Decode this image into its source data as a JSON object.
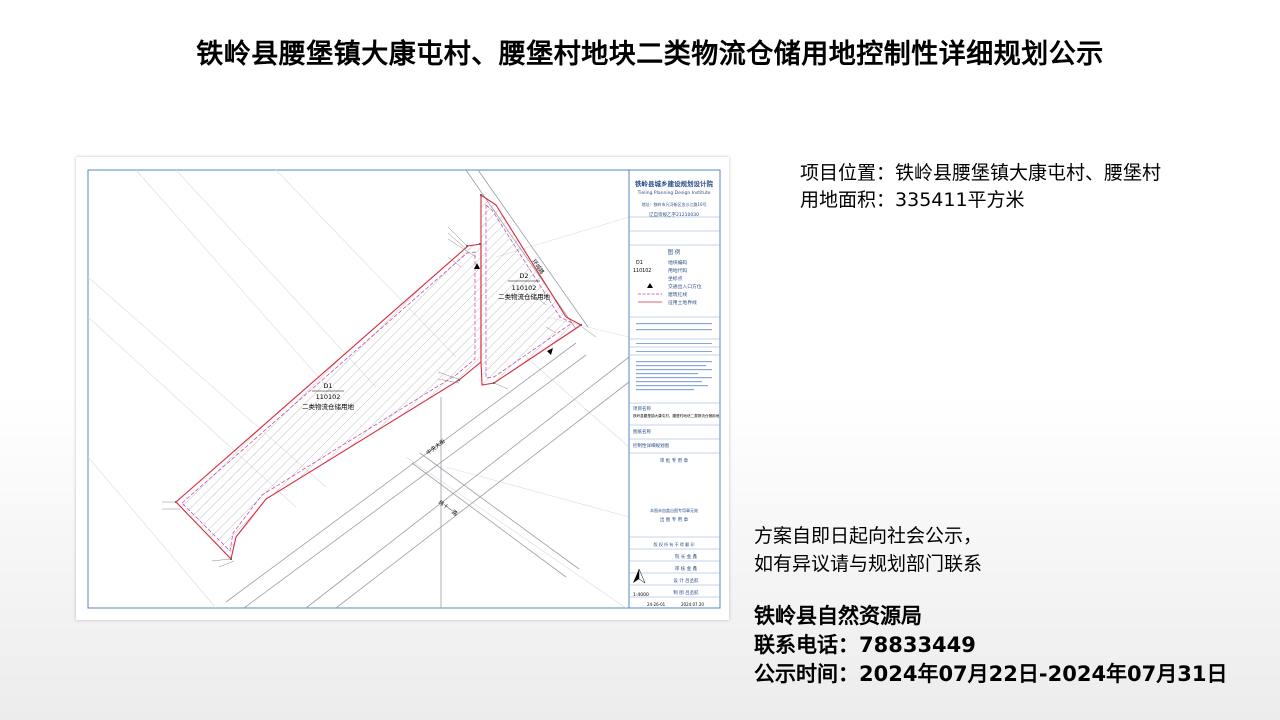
{
  "page": {
    "title": "铁岭县腰堡镇大康屯村、腰堡村地块二类物流仓储用地控制性详细规划公示"
  },
  "info": {
    "location_label": "项目位置：",
    "location_value": "铁岭县腰堡镇大康屯村、腰堡村",
    "area_label": "用地面积：",
    "area_value": "335411平方米"
  },
  "notice": {
    "line1": "方案自即日起向社会公示，",
    "line2": "如有异议请与规划部门联系"
  },
  "footer": {
    "org": "铁岭县自然资源局",
    "phone_label": "联系电话：",
    "phone_value": "78833449",
    "date_label": "公示时间：",
    "date_value": "2024年07月22日-2024年07月31日"
  },
  "map": {
    "parcel_d1": {
      "code": "D1",
      "landuse": "110102",
      "name": "二类物流仓储用地"
    },
    "parcel_d2": {
      "code": "D2",
      "landuse": "110102",
      "name": "二类物流仓储用地"
    },
    "roads": {
      "central_ave": "中央大街",
      "road_11": "纬十一路",
      "road_east": "环城路"
    },
    "titleblock": {
      "institute": "铁岭县城乡建设规划设计院",
      "institute_en": "Tieling Planning Design Institute",
      "address": "地址：铁岭市凡河新区金沙江路16号",
      "license": "辽自资规乙字21210030",
      "legend_title": "图  例",
      "legend": [
        {
          "code": "D1",
          "text": "地块编码"
        },
        {
          "code": "110102",
          "text": "用地代码"
        },
        {
          "code": "",
          "text": "坐标点"
        },
        {
          "code": "",
          "text": "交通出入口方位"
        },
        {
          "code": "",
          "text": "建筑红线"
        },
        {
          "code": "",
          "text": "征用土地界线"
        }
      ],
      "project_label": "项目名称",
      "project_value": "铁岭县腰堡镇大康屯村、腰堡村地块二类物流仓储用地",
      "drawing_label": "图纸名称",
      "drawing_value": "控制性详细规划图",
      "review_seal": "审 批 专 用 章",
      "no_seal_note": "本图未加盖出图专用章无效",
      "issue_seal": "出 图 专 用 章",
      "copyright": "版 权 所 有 不 得 翻 印",
      "roles": [
        "院 长 金 鑫",
        "审 核 金 鑫",
        "设 计 吕丞航",
        "制 图 吕丞航"
      ],
      "scale": "1:4000",
      "drawing_no": "24-26-01",
      "date": "2024.07.20"
    },
    "colors": {
      "boundary": "#d9293c",
      "building_line": "#c23fa8",
      "frame": "#5a86c4",
      "road": "#9aa0a6"
    }
  }
}
